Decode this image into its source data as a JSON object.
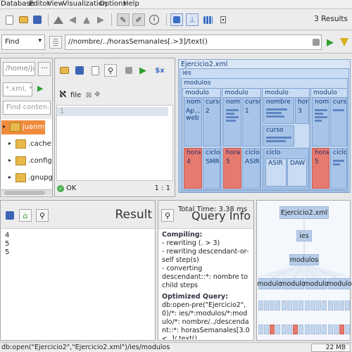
{
  "menu": [
    "Database",
    "Editor",
    "View",
    "Visualization",
    "Options",
    "Help"
  ],
  "toolbar": {
    "results_count": "3 Results",
    "icons": [
      "new-database-icon",
      "open-folder-icon",
      "save-icon",
      "home-icon",
      "back-icon",
      "up-icon",
      "forward-icon",
      "draw-icon",
      "brush-icon",
      "info-icon",
      "map-icon",
      "tree-icon",
      "table-icon",
      "dropdown-icon"
    ]
  },
  "search": {
    "mode": "Find",
    "query": "//nombre/../horasSemanales[.>3]/text()"
  },
  "filebrowser": {
    "path": "/home/jua",
    "filter_placeholder": "*.xml, *.xq*",
    "content_placeholder": "Find conten...",
    "items": [
      "juanma",
      ".cache",
      ".config",
      ".gnupg"
    ]
  },
  "editor": {
    "tab": "file",
    "line": "1",
    "status": "OK",
    "position": "1 : 1",
    "var_button": "$x"
  },
  "map": {
    "root": "Ejercicio2.xml",
    "ies": "ies",
    "modulos": "modulos",
    "modulo": "modulo",
    "nombre_short": "nom...",
    "nombre": "nombre",
    "curso": "curso",
    "horas_short": "hora...",
    "hor_short": "hor...",
    "ciclo": "ciclo",
    "ap_web": "Ap... web",
    "c1": "1",
    "c2": "2",
    "h4": "4",
    "h5": "5",
    "h3": "3",
    "smr": "SMR",
    "asir": "ASIR",
    "daw": "DAW"
  },
  "result": {
    "title": "Result",
    "values": [
      "4",
      "5",
      "5"
    ]
  },
  "queryinfo": {
    "title": "Query Info",
    "total_time": "Total Time: 3.38 ms",
    "compiling_heading": "Compiling:",
    "compiling": [
      "- rewriting (. > 3)",
      "- rewriting descendant-or-self step(s)",
      "- converting descendant::*: nombre to child steps"
    ],
    "optimized_heading": "Optimized Query:",
    "optimized": "db:open-pre(\"Ejercicio2\",0)/*: ies/*:modulos/*:modulo/*: nombre/../descendant::*: horasSemanales[3.0 < .]/ text()"
  },
  "tree": {
    "root": "Ejercicio2.xml",
    "ies": "ies",
    "modulos": "modulos",
    "modulo": "modulo"
  },
  "statusbar": {
    "path": "db:open(\"Ejercicio2\",\"Ejercicio2.xml\")/ies/modulos",
    "memory": "22 MB"
  }
}
